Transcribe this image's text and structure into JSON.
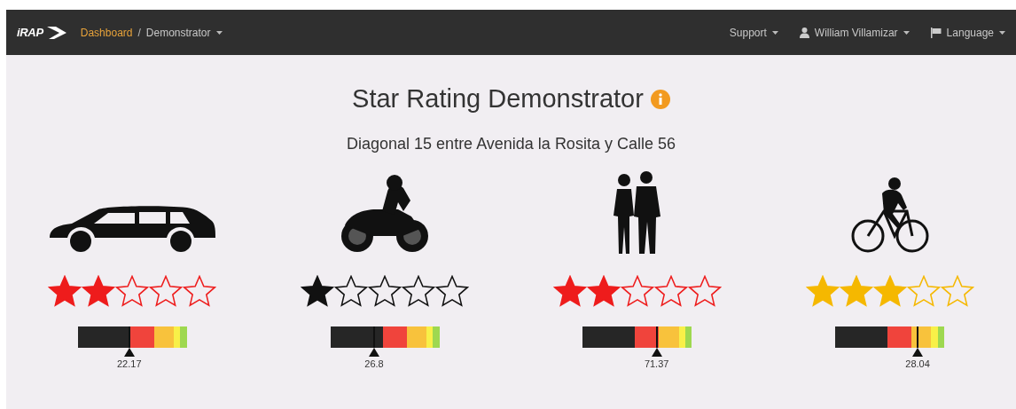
{
  "navbar": {
    "logo": "iRAP",
    "separator": "/",
    "breadcrumb": [
      {
        "label": "Dashboard",
        "selected": true
      },
      {
        "label": "Demonstrator",
        "selected": false
      }
    ],
    "menus": [
      {
        "label": "Support",
        "kind": "plain"
      },
      {
        "label": "William Villamizar",
        "kind": "user"
      },
      {
        "label": "Language",
        "kind": "flag"
      }
    ]
  },
  "title": "Star Rating Demonstrator",
  "subtitle": "Diagonal 15 entre Avenida la Rosita y Calle 56",
  "cards": [
    {
      "kind": "car",
      "stars": 2,
      "color": "#ee1c1c",
      "reading": "22.17"
    },
    {
      "kind": "motorcycle",
      "stars": 1,
      "color": "#111111",
      "reading": "26.8"
    },
    {
      "kind": "pedestrian",
      "stars": 2,
      "color": "#ee1c1c",
      "reading": "71.37"
    },
    {
      "kind": "bicycle",
      "stars": 3,
      "color": "#f5b800",
      "reading": "28.04"
    }
  ]
}
